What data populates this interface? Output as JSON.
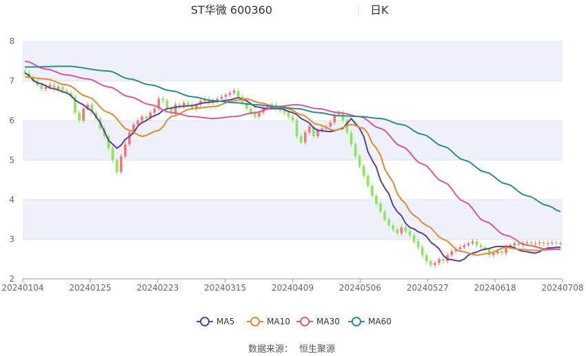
{
  "chart_data": {
    "type": "candlestick",
    "title": "ST华微 600360",
    "subtitle": "日K",
    "source_label": "数据来源：",
    "source_name": "恒生聚源",
    "x_tick_labels": [
      "20240104",
      "20240125",
      "20240223",
      "20240315",
      "20240409",
      "20240506",
      "20240527",
      "20240618",
      "20240708"
    ],
    "y_ticks": [
      2,
      3,
      4,
      5,
      6,
      7,
      8
    ],
    "ylim": [
      2,
      8
    ],
    "grid": true,
    "legend_position": "bottom",
    "colors": {
      "up": "#f07878",
      "down": "#88e85a",
      "band": "#eef1fa"
    },
    "series": [
      {
        "name": "MA5",
        "color": "#5a3d99",
        "anchors": [
          [
            0,
            7.2
          ],
          [
            3,
            6.95
          ],
          [
            7,
            6.8
          ],
          [
            10,
            6.7
          ],
          [
            13,
            6.45
          ],
          [
            16,
            6.25
          ],
          [
            18,
            5.95
          ],
          [
            20,
            5.5
          ],
          [
            22,
            5.3
          ],
          [
            25,
            5.6
          ],
          [
            28,
            5.95
          ],
          [
            31,
            6.12
          ],
          [
            34,
            6.3
          ],
          [
            37,
            6.35
          ],
          [
            40,
            6.38
          ],
          [
            43,
            6.45
          ],
          [
            46,
            6.48
          ],
          [
            49,
            6.52
          ],
          [
            51,
            6.58
          ],
          [
            53,
            6.5
          ],
          [
            55,
            6.35
          ],
          [
            58,
            6.3
          ],
          [
            61,
            6.3
          ],
          [
            64,
            6.2
          ],
          [
            67,
            6.0
          ],
          [
            70,
            5.75
          ],
          [
            73,
            5.72
          ],
          [
            76,
            5.8
          ],
          [
            78,
            6.05
          ],
          [
            80,
            5.8
          ],
          [
            83,
            5.0
          ],
          [
            86,
            4.3
          ],
          [
            89,
            3.7
          ],
          [
            92,
            3.3
          ],
          [
            95,
            3.15
          ],
          [
            98,
            2.85
          ],
          [
            101,
            2.5
          ],
          [
            104,
            2.45
          ],
          [
            107,
            2.65
          ],
          [
            110,
            2.75
          ],
          [
            113,
            2.82
          ],
          [
            116,
            2.82
          ],
          [
            119,
            2.7
          ],
          [
            122,
            2.65
          ],
          [
            125,
            2.78
          ],
          [
            128,
            2.8
          ]
        ]
      },
      {
        "name": "MA10",
        "color": "#e08a30",
        "anchors": [
          [
            0,
            7.1
          ],
          [
            5,
            7.05
          ],
          [
            10,
            6.9
          ],
          [
            15,
            6.6
          ],
          [
            20,
            6.2
          ],
          [
            25,
            5.75
          ],
          [
            28,
            5.6
          ],
          [
            32,
            5.75
          ],
          [
            35,
            6.1
          ],
          [
            40,
            6.3
          ],
          [
            45,
            6.35
          ],
          [
            50,
            6.5
          ],
          [
            53,
            6.55
          ],
          [
            56,
            6.45
          ],
          [
            60,
            6.35
          ],
          [
            63,
            6.3
          ],
          [
            66,
            6.15
          ],
          [
            70,
            5.9
          ],
          [
            74,
            5.75
          ],
          [
            78,
            5.9
          ],
          [
            81,
            5.8
          ],
          [
            84,
            5.3
          ],
          [
            87,
            4.6
          ],
          [
            90,
            4.0
          ],
          [
            93,
            3.6
          ],
          [
            96,
            3.35
          ],
          [
            100,
            3.0
          ],
          [
            104,
            2.7
          ],
          [
            108,
            2.6
          ],
          [
            111,
            2.65
          ],
          [
            115,
            2.8
          ],
          [
            118,
            2.75
          ],
          [
            122,
            2.72
          ],
          [
            128,
            2.75
          ]
        ]
      },
      {
        "name": "MA30",
        "color": "#d855a0",
        "anchors": [
          [
            0,
            7.5
          ],
          [
            5,
            7.3
          ],
          [
            10,
            7.15
          ],
          [
            15,
            7.05
          ],
          [
            20,
            6.85
          ],
          [
            25,
            6.6
          ],
          [
            30,
            6.4
          ],
          [
            35,
            6.2
          ],
          [
            40,
            6.1
          ],
          [
            45,
            6.05
          ],
          [
            50,
            6.1
          ],
          [
            55,
            6.2
          ],
          [
            60,
            6.35
          ],
          [
            65,
            6.4
          ],
          [
            70,
            6.3
          ],
          [
            75,
            6.2
          ],
          [
            80,
            6.1
          ],
          [
            85,
            5.8
          ],
          [
            90,
            5.35
          ],
          [
            95,
            4.9
          ],
          [
            100,
            4.45
          ],
          [
            105,
            3.95
          ],
          [
            110,
            3.45
          ],
          [
            115,
            3.1
          ],
          [
            120,
            2.85
          ],
          [
            125,
            2.75
          ],
          [
            128,
            2.75
          ]
        ]
      },
      {
        "name": "MA60",
        "color": "#2e8b8b",
        "anchors": [
          [
            0,
            7.35
          ],
          [
            10,
            7.37
          ],
          [
            20,
            7.25
          ],
          [
            25,
            7.05
          ],
          [
            30,
            6.9
          ],
          [
            35,
            6.75
          ],
          [
            40,
            6.6
          ],
          [
            45,
            6.5
          ],
          [
            50,
            6.45
          ],
          [
            55,
            6.4
          ],
          [
            60,
            6.35
          ],
          [
            65,
            6.3
          ],
          [
            70,
            6.2
          ],
          [
            75,
            6.12
          ],
          [
            80,
            6.1
          ],
          [
            85,
            6.05
          ],
          [
            90,
            5.9
          ],
          [
            95,
            5.65
          ],
          [
            100,
            5.35
          ],
          [
            105,
            5.0
          ],
          [
            110,
            4.7
          ],
          [
            115,
            4.4
          ],
          [
            120,
            4.1
          ],
          [
            125,
            3.85
          ],
          [
            128,
            3.7
          ]
        ]
      }
    ],
    "candles_close": [
      7.2,
      7.1,
      7.0,
      6.9,
      6.8,
      6.85,
      6.9,
      6.8,
      6.85,
      6.75,
      6.7,
      6.6,
      6.2,
      6.0,
      6.3,
      6.4,
      6.2,
      6.05,
      5.8,
      5.6,
      5.3,
      5.0,
      4.7,
      5.1,
      5.4,
      5.7,
      5.9,
      6.0,
      6.1,
      6.05,
      6.2,
      6.3,
      6.55,
      6.5,
      6.3,
      6.2,
      6.4,
      6.35,
      6.45,
      6.4,
      6.3,
      6.4,
      6.5,
      6.55,
      6.45,
      6.5,
      6.55,
      6.6,
      6.65,
      6.7,
      6.75,
      6.6,
      6.45,
      6.3,
      6.2,
      6.1,
      6.2,
      6.3,
      6.35,
      6.4,
      6.3,
      6.25,
      6.2,
      6.1,
      6.0,
      5.6,
      5.45,
      5.7,
      5.85,
      5.6,
      5.75,
      5.8,
      5.85,
      5.95,
      6.15,
      6.2,
      6.0,
      5.7,
      5.4,
      5.1,
      4.85,
      4.6,
      4.35,
      4.1,
      3.9,
      3.7,
      3.5,
      3.35,
      3.25,
      3.15,
      3.3,
      3.2,
      3.1,
      2.95,
      2.8,
      2.6,
      2.45,
      2.35,
      2.4,
      2.5,
      2.45,
      2.6,
      2.7,
      2.75,
      2.8,
      2.85,
      2.9,
      2.95,
      2.85,
      2.8,
      2.75,
      2.6,
      2.65,
      2.7,
      2.65,
      2.8,
      2.85,
      2.9,
      2.85,
      2.9,
      2.92,
      2.88,
      2.9,
      2.92,
      2.88,
      2.9,
      2.92,
      2.9,
      2.9
    ]
  }
}
